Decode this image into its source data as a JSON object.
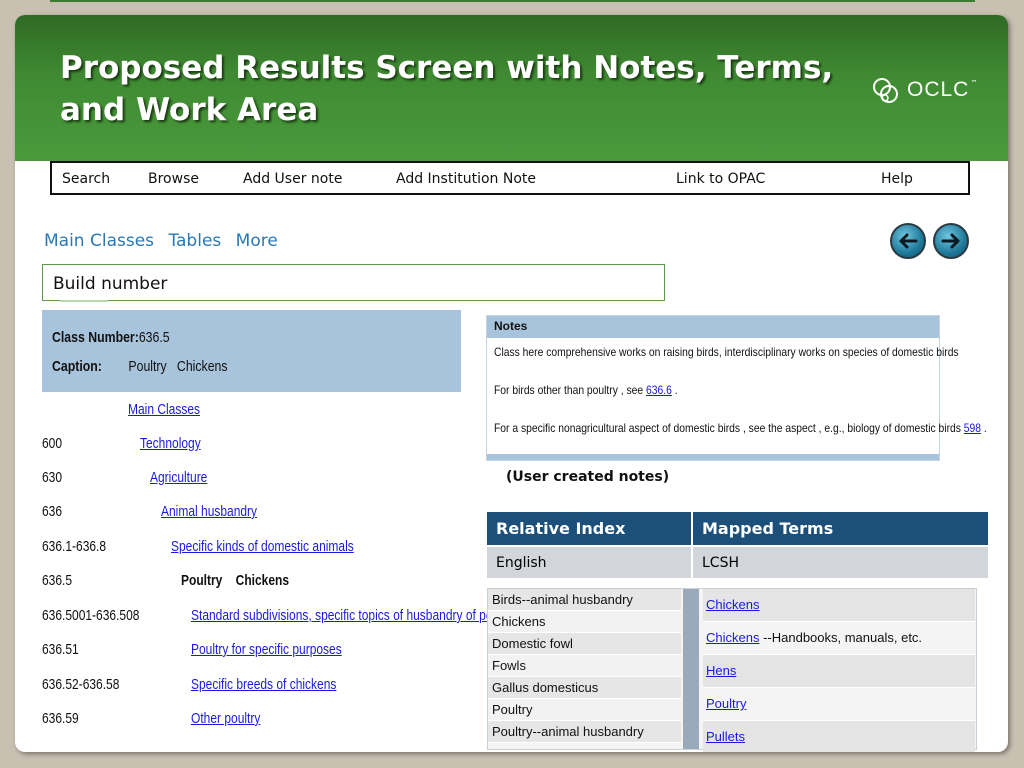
{
  "slide": {
    "title": "Proposed Results Screen with Notes, Terms, and Work Area",
    "logo_text": "OCLC",
    "logo_tm": "™"
  },
  "menu": [
    "Search",
    "Browse",
    "Add User note",
    "Add Institution Note",
    "Link to OPAC",
    "Help"
  ],
  "tabs": [
    "Main Classes",
    "Tables",
    "More"
  ],
  "nav": {
    "back_icon": "arrow-left-icon",
    "forward_icon": "arrow-right-icon"
  },
  "build_number_label": "Build number",
  "class_header": {
    "number_label": "Class Number:",
    "number_value": "636.5",
    "caption_label": "Caption:",
    "caption_value": "Poultry   Chickens"
  },
  "hierarchy": [
    {
      "num": "",
      "text": "Main Classes",
      "link": true
    },
    {
      "num": "600",
      "text": "Technology",
      "link": true
    },
    {
      "num": "630",
      "text": "Agriculture",
      "link": true
    },
    {
      "num": "636",
      "text": "Animal husbandry",
      "link": true
    },
    {
      "num": "636.1-636.8",
      "text": "Specific kinds of domestic animals",
      "link": true
    },
    {
      "num": "636.5",
      "text": "Poultry    Chickens",
      "link": false
    },
    {
      "num": "636.5001-636.508",
      "text": "Standard subdivisions, specific topics of husbandry of poultry",
      "link": true
    },
    {
      "num": "636.51",
      "text": "Poultry for specific purposes",
      "link": true
    },
    {
      "num": "636.52-636.58",
      "text": "Specific breeds of chickens",
      "link": true
    },
    {
      "num": "636.59",
      "text": "Other poultry",
      "link": true
    }
  ],
  "notes": {
    "header": "Notes",
    "line1": "Class here comprehensive works on raising birds, interdisciplinary works on species of domestic birds",
    "line2_pre": "For birds other than poultry , see ",
    "line2_link": "636.6",
    "line2_post": " .",
    "line3_pre": "For a specific nonagricultural aspect of domestic birds , see the aspect , e.g., biology of domestic birds ",
    "line3_link": "598",
    "line3_post": " ."
  },
  "user_notes_label": "(User created notes)",
  "relative_index": {
    "headers": [
      "Relative Index",
      "Mapped Terms"
    ],
    "row": [
      "English",
      "LCSH"
    ]
  },
  "index_terms": [
    "Birds--animal husbandry",
    "Chickens",
    "Domestic fowl",
    "Fowls",
    "Gallus domesticus",
    "Poultry",
    "Poultry--animal husbandry"
  ],
  "mapped_terms": [
    {
      "link": "Chickens",
      "suffix": ""
    },
    {
      "link": "Chickens",
      "suffix": " --Handbooks, manuals, etc."
    },
    {
      "link": "Hens",
      "suffix": ""
    },
    {
      "link": "Poultry",
      "suffix": ""
    },
    {
      "link": "Pullets",
      "suffix": ""
    }
  ]
}
